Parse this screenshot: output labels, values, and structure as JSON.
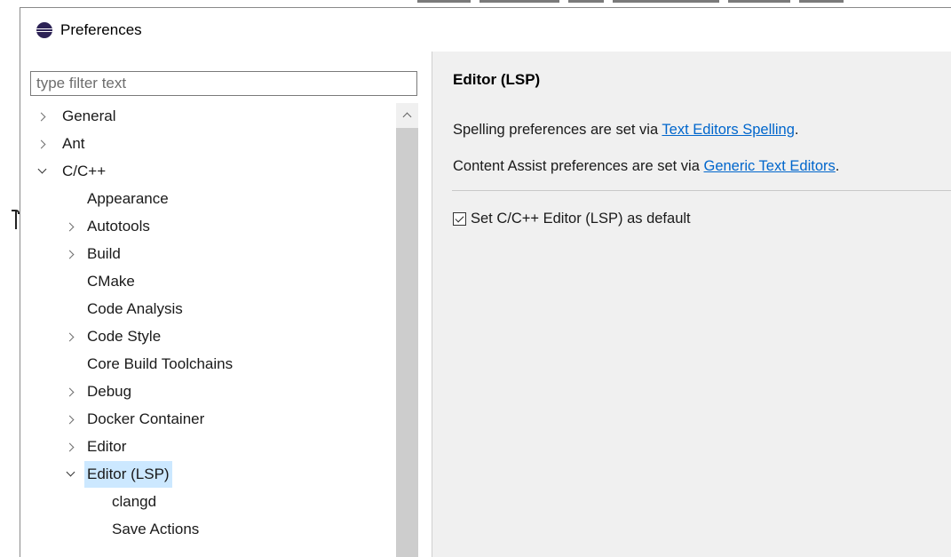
{
  "window": {
    "title": "Preferences"
  },
  "filter": {
    "placeholder": "type filter text",
    "value": ""
  },
  "tree": {
    "items": [
      {
        "label": "General",
        "expander": "collapsed"
      },
      {
        "label": "Ant",
        "expander": "collapsed"
      },
      {
        "label": "C/C++",
        "expander": "expanded"
      },
      {
        "label": "Appearance",
        "expander": "none"
      },
      {
        "label": "Autotools",
        "expander": "collapsed"
      },
      {
        "label": "Build",
        "expander": "collapsed"
      },
      {
        "label": "CMake",
        "expander": "none"
      },
      {
        "label": "Code Analysis",
        "expander": "none"
      },
      {
        "label": "Code Style",
        "expander": "collapsed"
      },
      {
        "label": "Core Build Toolchains",
        "expander": "none"
      },
      {
        "label": "Debug",
        "expander": "collapsed"
      },
      {
        "label": "Docker Container",
        "expander": "collapsed"
      },
      {
        "label": "Editor",
        "expander": "collapsed"
      },
      {
        "label": "Editor (LSP)",
        "expander": "expanded",
        "selected": true
      },
      {
        "label": "clangd",
        "expander": "none"
      },
      {
        "label": "Save Actions",
        "expander": "none"
      }
    ]
  },
  "page": {
    "title": "Editor (LSP)",
    "spelling": {
      "prefix": "Spelling preferences are set via ",
      "link": "Text Editors Spelling",
      "suffix": "."
    },
    "content_assist": {
      "prefix": "Content Assist preferences are set via ",
      "link": "Generic Text Editors",
      "suffix": "."
    },
    "default_checkbox": {
      "label": "Set C/C++ Editor (LSP) as default",
      "checked": true
    }
  },
  "colors": {
    "selection": "#cce8ff",
    "link": "#0066cc",
    "right_pane_bg": "#f0f0f0",
    "app_icon": "#2c2255"
  },
  "icons": {
    "app": "eclipse-icon",
    "collapsed": "chevron-right-icon",
    "expanded": "chevron-down-icon",
    "scroll_up": "chevron-up-icon"
  }
}
